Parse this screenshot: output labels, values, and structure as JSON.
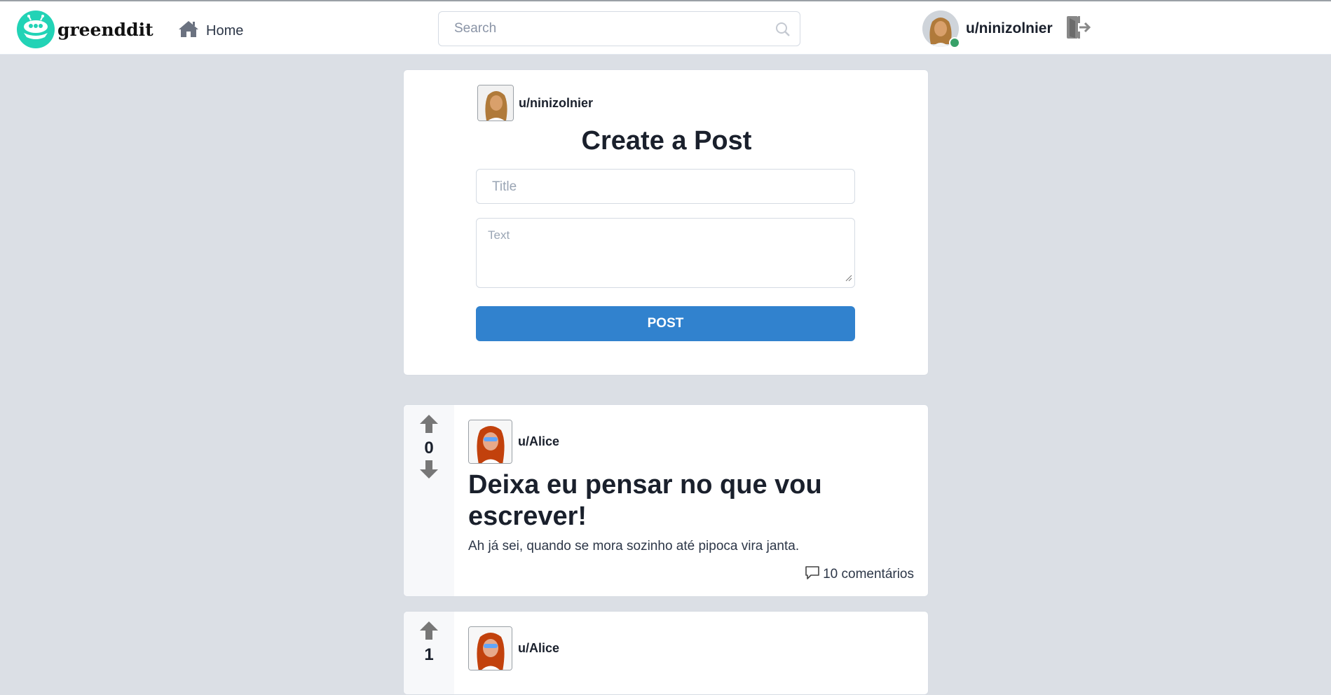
{
  "app": {
    "brand": "greenddit",
    "accent_color": "#22d3b6",
    "primary_button_color": "#3182ce"
  },
  "header": {
    "home_label": "Home",
    "search_placeholder": "Search",
    "search_value": "",
    "username": "u/ninizolnier",
    "online_status_color": "#38a169",
    "icons": [
      "alien-logo-icon",
      "home-icon",
      "search-icon",
      "logout-icon"
    ]
  },
  "create_post": {
    "username": "u/ninizolnier",
    "heading": "Create a Post",
    "title_placeholder": "Title",
    "title_value": "",
    "text_placeholder": "Text",
    "text_value": "",
    "submit_label": "POST"
  },
  "posts": [
    {
      "votes": "0",
      "author": "u/Alice",
      "title": "Deixa eu pensar no que vou escrever!",
      "body": "Ah já sei, quando se mora sozinho até pipoca vira janta.",
      "comments_label": "10 comentários"
    },
    {
      "votes": "1",
      "author": "u/Alice"
    }
  ]
}
